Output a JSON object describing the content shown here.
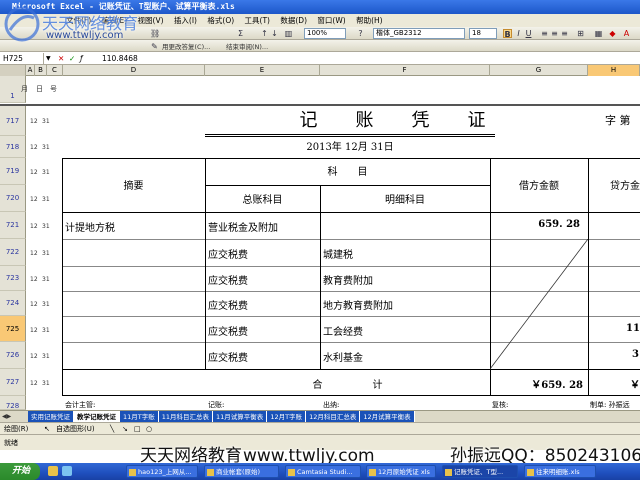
{
  "window": {
    "title": "Microsoft Excel - 记账凭证、T型账户、试算平衡表.xls"
  },
  "menu": [
    "文件(F)",
    "编辑(E)",
    "视图(V)",
    "插入(I)",
    "格式(O)",
    "工具(T)",
    "数据(D)",
    "窗口(W)",
    "帮助(H)"
  ],
  "toolbar": {
    "zoom": "100%",
    "font": "楷体_GB2312",
    "size": "18",
    "bold": "B",
    "italic": "I",
    "underline": "U",
    "reply_label": "用更改答复(C)...",
    "end_review_label": "结束审阅(N)..."
  },
  "formula": {
    "name_box": "H725",
    "value": "110.8468"
  },
  "columns": [
    "A",
    "B",
    "C",
    "D",
    "E",
    "F",
    "G",
    "H"
  ],
  "row1_labels": [
    "月",
    "日",
    "号"
  ],
  "rows": [
    {
      "num": "717",
      "a": "12",
      "b": "31"
    },
    {
      "num": "718",
      "a": "12",
      "b": "31"
    },
    {
      "num": "719",
      "a": "12",
      "b": "31"
    },
    {
      "num": "720",
      "a": "12",
      "b": "31"
    },
    {
      "num": "721",
      "a": "12",
      "b": "31"
    },
    {
      "num": "722",
      "a": "12",
      "b": "31"
    },
    {
      "num": "723",
      "a": "12",
      "b": "31"
    },
    {
      "num": "724",
      "a": "12",
      "b": "31"
    },
    {
      "num": "725",
      "a": "12",
      "b": "31"
    },
    {
      "num": "726",
      "a": "12",
      "b": "31"
    },
    {
      "num": "727",
      "a": "12",
      "b": "31"
    },
    {
      "num": "728",
      "a": "",
      "b": ""
    }
  ],
  "voucher": {
    "title": "记　账　凭　证",
    "number_label": "字  第",
    "date": "2013年  12月  31日",
    "subject_header": "科　　目",
    "summary_header": "摘要",
    "general_header": "总账科目",
    "detail_header": "明细科目",
    "debit_header": "借方金额",
    "credit_header": "贷方金",
    "lines": [
      {
        "summary": "计提地方税",
        "general": "营业税金及附加",
        "detail": "",
        "debit": "659. 28",
        "credit": ""
      },
      {
        "summary": "",
        "general": "应交税费",
        "detail": "城建税",
        "debit": "",
        "credit": ""
      },
      {
        "summary": "",
        "general": "应交税费",
        "detail": "教育费附加",
        "debit": "",
        "credit": ""
      },
      {
        "summary": "",
        "general": "应交税费",
        "detail": "地方教育费附加",
        "debit": "",
        "credit": ""
      },
      {
        "summary": "",
        "general": "应交税费",
        "detail": "工会经费",
        "debit": "",
        "credit": "11"
      },
      {
        "summary": "",
        "general": "应交税费",
        "detail": "水利基金",
        "debit": "",
        "credit": "3"
      }
    ],
    "total_label": "合　　　　　计",
    "total_debit": "￥659. 28",
    "total_credit": "￥",
    "footer": {
      "supervisor": "会计主管:",
      "bookkeeper": "记账:",
      "cashier": "出纳:",
      "reviewer": "复核:",
      "maker": "制单: 孙振远"
    }
  },
  "sheet_tabs": [
    "实用记账凭证",
    "教学记账凭证",
    "11月T字账",
    "11月科目汇总表",
    "11月试算平衡表",
    "12月T字账",
    "12月科目汇总表",
    "12月试算平衡表"
  ],
  "active_tab": 1,
  "drawbar": {
    "draw": "绘图(R)",
    "autoshapes": "自选图形(U)"
  },
  "status": {
    "ready": "就绪"
  },
  "watermark": {
    "brand": "天天网络教育",
    "url": "www.ttwljy.com",
    "contact": "孙振远QQ：850243106"
  },
  "logo": {
    "brand": "天天网络教育",
    "url": "www.ttwljy.com"
  },
  "taskbar": {
    "start": "开始",
    "tasks": [
      "hao123_上网从...",
      "商业帐套(原始)",
      "Camtasia Studi...",
      "12月原始凭证 xls",
      "记账凭证、T型...",
      "往来明细账.xls"
    ]
  },
  "colors": {
    "title_blue": "#1d57c9",
    "tab_blue": "#1a52b8",
    "selected_row": "#f9c875"
  }
}
